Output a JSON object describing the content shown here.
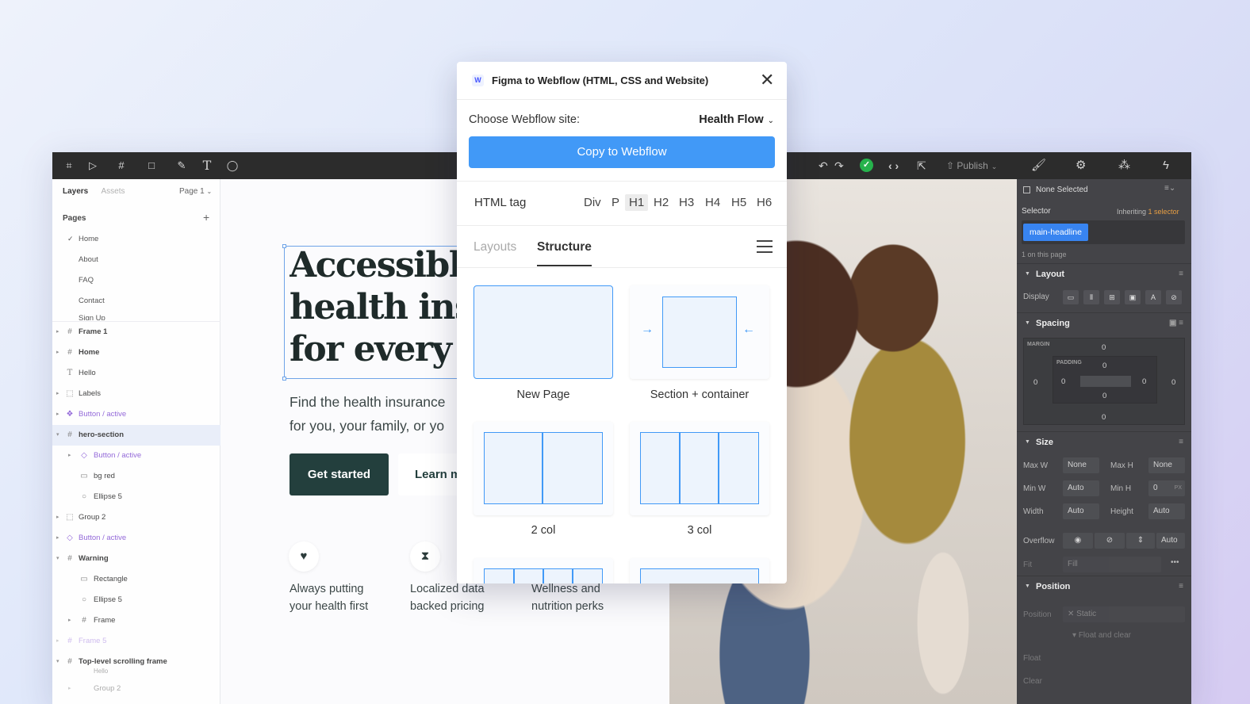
{
  "app": {
    "toolbar": {
      "publish_label": "Publish"
    },
    "layers_panel": {
      "tabs": [
        "Layers",
        "Assets"
      ],
      "page_selector": "Page 1",
      "pages_heading": "Pages",
      "pages": [
        "Home",
        "About",
        "FAQ",
        "Contact",
        "Sign Up"
      ],
      "layers": [
        {
          "label": "Frame 1",
          "icon": "frame-icon"
        },
        {
          "label": "Home",
          "icon": "frame-icon"
        },
        {
          "label": "Hello",
          "icon": "text-icon"
        },
        {
          "label": "Labels",
          "icon": "group-icon"
        },
        {
          "label": "Button / active",
          "icon": "component-icon"
        },
        {
          "label": "hero-section",
          "icon": "frame-icon"
        },
        {
          "label": "Button / active",
          "icon": "instance-icon"
        },
        {
          "label": "bg red",
          "icon": "rect-icon"
        },
        {
          "label": "Ellipse 5",
          "icon": "ellipse-icon"
        },
        {
          "label": "Group 2",
          "icon": "group-icon"
        },
        {
          "label": "Button / active",
          "icon": "instance-icon"
        },
        {
          "label": "Warning",
          "icon": "frame-icon"
        },
        {
          "label": "Rectangle",
          "icon": "rect-icon"
        },
        {
          "label": "Ellipse 5",
          "icon": "ellipse-icon"
        },
        {
          "label": "Frame",
          "icon": "frame-icon"
        },
        {
          "label": "Frame 5",
          "icon": "frame-icon"
        },
        {
          "label": "Top-level scrolling frame",
          "icon": "frame-icon"
        },
        {
          "label": "Hello",
          "icon": "text-icon"
        },
        {
          "label": "Group 2",
          "icon": "group-icon"
        }
      ]
    },
    "canvas": {
      "headline_lines": [
        "Accessible",
        "health ins",
        "for every"
      ],
      "subtext_lines": [
        "Find the health insurance",
        "for you, your family, or yo"
      ],
      "primary_button": "Get started",
      "secondary_button": "Learn m",
      "features": [
        {
          "icon": "heart-icon",
          "line1": "Always putting",
          "line2": "your health first"
        },
        {
          "icon": "hourglass-icon",
          "line1": "Localized data",
          "line2": "backed pricing"
        },
        {
          "icon": "",
          "line1": "Wellness and",
          "line2": "nutrition perks"
        }
      ]
    },
    "style_panel": {
      "none_selected": "None Selected",
      "selector_label": "Selector",
      "inheriting": "Inheriting",
      "inheriting_link": "1 selector",
      "selector_chip": "main-headline",
      "on_page": "1 on this page",
      "sections": {
        "layout": "Layout",
        "spacing": "Spacing",
        "size": "Size",
        "position": "Position"
      },
      "display_label": "Display",
      "margin_caption": "MARGIN",
      "padding_caption": "PADDING",
      "spacing_values": {
        "margin_top": "0",
        "margin_left": "0",
        "margin_right": "0",
        "margin_bottom": "0",
        "padding_top": "0",
        "padding_left": "0",
        "padding_right": "0",
        "padding_bottom": "0"
      },
      "size_fields": [
        {
          "label": "Max W",
          "value": "None"
        },
        {
          "label": "Max H",
          "value": "None"
        },
        {
          "label": "Min W",
          "value": "Auto"
        },
        {
          "label": "Min H",
          "value": "0"
        },
        {
          "label": "Width",
          "value": "Auto"
        },
        {
          "label": "Height",
          "value": "Auto"
        }
      ],
      "min_h_unit": "PX",
      "overflow_label": "Overflow",
      "overflow_auto": "Auto",
      "fit_label": "Fit",
      "fit_value": "Fill",
      "position_label": "Position",
      "position_value": "Static",
      "float_clear": "Float and clear",
      "float_label": "Float",
      "clear_label": "Clear"
    }
  },
  "modal": {
    "title": "Figma to Webflow (HTML, CSS and Website)",
    "logo_letter": "W",
    "site_label": "Choose Webflow site:",
    "site_value": "Health Flow",
    "copy_button": "Copy to Webflow",
    "html_tag_label": "HTML tag",
    "html_tags": [
      "Div",
      "P",
      "H1",
      "H2",
      "H3",
      "H4",
      "H5",
      "H6"
    ],
    "selected_tag": "H1",
    "tabs": [
      "Layouts",
      "Structure"
    ],
    "active_tab": "Structure",
    "cards": [
      "New Page",
      "Section + container",
      "2 col",
      "3 col"
    ]
  }
}
